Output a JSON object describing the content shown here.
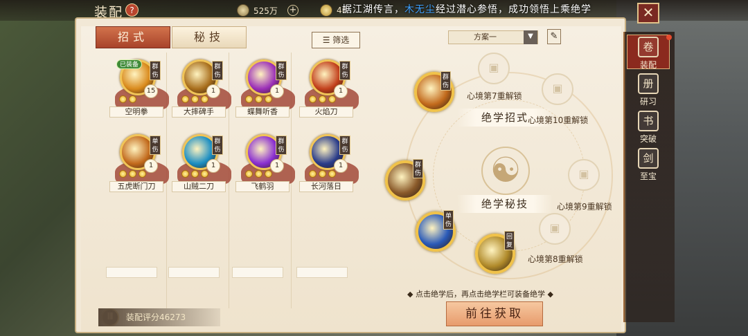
{
  "header": {
    "title": "装配",
    "help_icon": "?",
    "currency_1": {
      "icon": "coin-icon",
      "value": "525万"
    },
    "currency_2": {
      "icon": "ingot-icon",
      "value": "48"
    },
    "notice_prefix": "据江湖传言，",
    "notice_highlight": "木无尘",
    "notice_suffix": "经过潜心参悟，成功领悟上乘绝学"
  },
  "tabs": {
    "moves": "招式",
    "secrets": "秘技"
  },
  "filter_label": "筛选",
  "skills": [
    {
      "name": "空明拳",
      "tag": "群伤",
      "level": "15",
      "equipped": "已装备",
      "stars": 2,
      "color": "#d98a1c"
    },
    {
      "name": "大摔碑手",
      "tag": "群伤",
      "level": "1",
      "stars": 3,
      "color": "#a86e1c"
    },
    {
      "name": "蝶舞听香",
      "tag": "群伤",
      "level": "1",
      "stars": 3,
      "color": "#9b2fb8"
    },
    {
      "name": "火焰刀",
      "tag": "群伤",
      "level": "1",
      "stars": 3,
      "color": "#c2401c"
    },
    {
      "name": "五虎断门刀",
      "tag": "单伤",
      "level": "1",
      "stars": 3,
      "color": "#c26a1c"
    },
    {
      "name": "山贼二刀",
      "tag": "群伤",
      "level": "1",
      "stars": 3,
      "color": "#1c8ec2"
    },
    {
      "name": "飞鹤羽",
      "tag": "群伤",
      "level": "1",
      "stars": 3,
      "color": "#8a2fd0"
    },
    {
      "name": "长河落日",
      "tag": "群伤",
      "level": "1",
      "stars": 3,
      "color": "#2a3c8a"
    }
  ],
  "score_label": "装配评分46273",
  "plan": {
    "selected": "方案一",
    "edit_icon": "brush-icon"
  },
  "wheel": {
    "moves_label": "绝学招式",
    "secrets_label": "绝学秘技",
    "lock_7": "心境第7重解锁",
    "lock_10": "心境第10重解锁",
    "lock_9": "心境第9重解锁",
    "lock_8": "心境第8重解锁",
    "equipped": [
      {
        "tag": "群伤",
        "color": "#c26a1c"
      },
      {
        "tag": "群伤",
        "color": "#8a5a2a"
      },
      {
        "tag": "单伤",
        "color": "#2a5ab8"
      },
      {
        "tag": "回复",
        "color": "#b08a2a"
      }
    ]
  },
  "hint": "◆ 点击绝学后，再点击绝学栏可装备绝学 ◆",
  "get_button": "前往获取",
  "side_menu": [
    {
      "label": "装配",
      "icon": "equip-icon"
    },
    {
      "label": "研习",
      "icon": "study-icon"
    },
    {
      "label": "突破",
      "icon": "breakthrough-icon"
    },
    {
      "label": "至宝",
      "icon": "treasure-icon"
    }
  ]
}
